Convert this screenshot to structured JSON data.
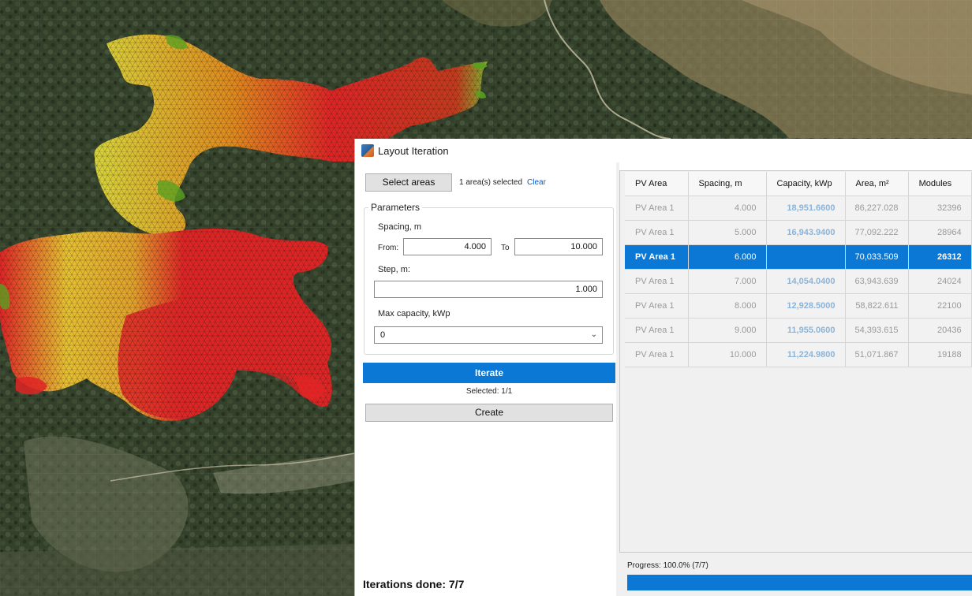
{
  "window": {
    "title": "Layout Iteration",
    "icon": "layout-iteration-app-icon"
  },
  "left_panel": {
    "select_areas_label": "Select areas",
    "selected_count": "1 area(s) selected",
    "clear_label": "Clear",
    "parameters": {
      "legend": "Parameters",
      "spacing_label": "Spacing, m",
      "from_label": "From:",
      "from_value": "4.000",
      "to_label": "To",
      "to_value": "10.000",
      "step_label": "Step, m:",
      "step_value": "1.000",
      "max_capacity_label": "Max capacity, kWp",
      "max_capacity_value": "0",
      "chevron_icon": "chevron-down-icon"
    },
    "iterate_label": "Iterate",
    "selected_ratio": "Selected: 1/1",
    "create_label": "Create",
    "iterations_done": "Iterations done: 7/7"
  },
  "results_table": {
    "columns": [
      "PV Area",
      "Spacing, m",
      "Capacity, kWp",
      "Area, m²",
      "Modules"
    ],
    "rows": [
      {
        "area": "PV Area 1",
        "spacing": "4.000",
        "capacity": "18,951.6600",
        "area_m2": "86,227.028",
        "modules": "32396"
      },
      {
        "area": "PV Area 1",
        "spacing": "5.000",
        "capacity": "16,943.9400",
        "area_m2": "77,092.222",
        "modules": "28964"
      },
      {
        "area": "PV Area 1",
        "spacing": "6.000",
        "capacity": "",
        "area_m2": "70,033.509",
        "modules": "26312"
      },
      {
        "area": "PV Area 1",
        "spacing": "7.000",
        "capacity": "14,054.0400",
        "area_m2": "63,943.639",
        "modules": "24024"
      },
      {
        "area": "PV Area 1",
        "spacing": "8.000",
        "capacity": "12,928.5000",
        "area_m2": "58,822.611",
        "modules": "22100"
      },
      {
        "area": "PV Area 1",
        "spacing": "9.000",
        "capacity": "11,955.0600",
        "area_m2": "54,393.615",
        "modules": "20436"
      },
      {
        "area": "PV Area 1",
        "spacing": "10.000",
        "capacity": "11,224.9800",
        "area_m2": "51,071.867",
        "modules": "19188"
      }
    ],
    "selected_row": 2
  },
  "progress": {
    "label": "Progress: 100.0% (7/7)",
    "fraction": 1.0
  },
  "colors": {
    "accent": "#0a78d4",
    "mesh_red": "#e02020",
    "mesh_orange": "#e08a1c",
    "mesh_yellow": "#e6e030",
    "mesh_green": "#5aa020"
  }
}
